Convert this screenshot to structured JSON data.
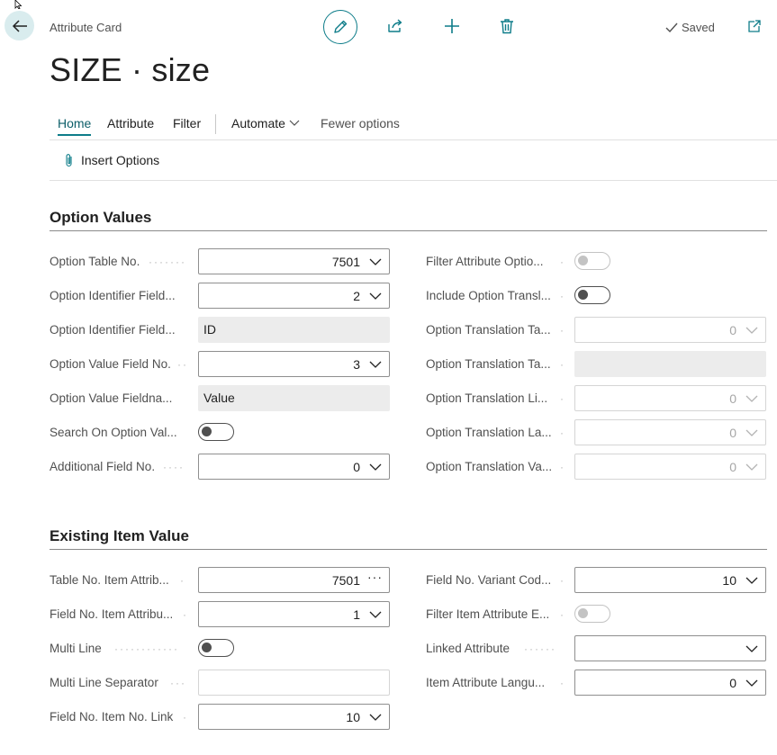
{
  "header": {
    "caption": "Attribute Card",
    "title": "SIZE · size",
    "saved_label": "Saved"
  },
  "menu": {
    "items": [
      "Home",
      "Attribute",
      "Filter",
      "Automate",
      "Fewer options"
    ]
  },
  "actions": {
    "insert_options": "Insert Options"
  },
  "option_values": {
    "title": "Option Values",
    "left": [
      {
        "label": "Option Table No.",
        "value": "7501"
      },
      {
        "label": "Option Identifier Field...",
        "value": "2"
      },
      {
        "label": "Option Identifier Field...",
        "value": "ID"
      },
      {
        "label": "Option Value Field No.",
        "value": "3"
      },
      {
        "label": "Option Value Fieldna...",
        "value": "Value"
      },
      {
        "label": "Search On Option Val...",
        "value": "off"
      },
      {
        "label": "Additional Field No.",
        "value": "0"
      }
    ],
    "right": [
      {
        "label": "Filter Attribute Optio...",
        "value": "off"
      },
      {
        "label": "Include Option Transl...",
        "value": "off"
      },
      {
        "label": "Option Translation Ta...",
        "value": "0"
      },
      {
        "label": "Option Translation Ta...",
        "value": ""
      },
      {
        "label": "Option Translation Li...",
        "value": "0"
      },
      {
        "label": "Option Translation La...",
        "value": "0"
      },
      {
        "label": "Option Translation Va...",
        "value": "0"
      }
    ]
  },
  "existing_item_value": {
    "title": "Existing Item Value",
    "left": [
      {
        "label": "Table No. Item Attrib...",
        "value": "7501"
      },
      {
        "label": "Field No. Item Attribu...",
        "value": "1"
      },
      {
        "label": "Multi Line",
        "value": "off"
      },
      {
        "label": "Multi Line Separator",
        "value": ""
      },
      {
        "label": "Field No. Item No. Link",
        "value": "10"
      }
    ],
    "right": [
      {
        "label": "Field No. Variant Cod...",
        "value": "10"
      },
      {
        "label": "Filter Item Attribute E...",
        "value": "off"
      },
      {
        "label": "Linked Attribute",
        "value": ""
      },
      {
        "label": "Item Attribute Langu...",
        "value": "0"
      }
    ]
  },
  "colors": {
    "accent": "#0d7c89",
    "label": "#505050",
    "readonly_bg": "#ececec"
  }
}
